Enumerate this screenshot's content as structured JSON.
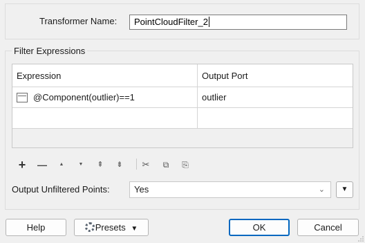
{
  "name_section": {
    "label": "Transformer Name:",
    "value": "PointCloudFilter_2"
  },
  "filter": {
    "group_title": "Filter Expressions",
    "columns": [
      "Expression",
      "Output Port"
    ],
    "rows": [
      {
        "expression": "@Component(outlier)==1",
        "output_port": "outlier"
      }
    ]
  },
  "toolbar": {
    "add": "+",
    "remove": "—",
    "move_up": "▲",
    "move_down": "▼",
    "move_top": "⇞",
    "move_bottom": "⇟",
    "cut": "✂",
    "copy": "⧉",
    "paste": "⎘"
  },
  "unfiltered": {
    "label": "Output Unfiltered Points:",
    "selected": "Yes",
    "dropdown_chevron": "⌄",
    "menu_arrow": "▼"
  },
  "buttons": {
    "help": "Help",
    "presets": "Presets",
    "presets_arrow": "▼",
    "ok": "OK",
    "cancel": "Cancel"
  },
  "colors": {
    "background": "#f0f0f0",
    "ok_border": "#0067c0"
  }
}
